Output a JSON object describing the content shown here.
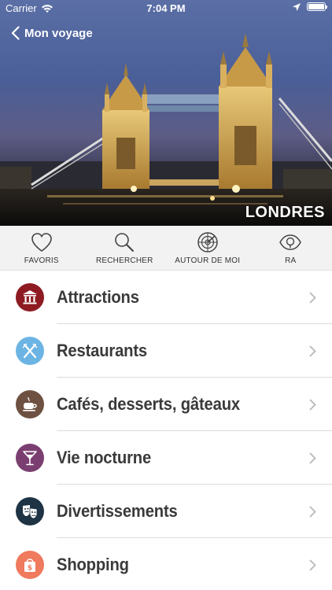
{
  "status_bar": {
    "carrier": "Carrier",
    "time": "7:04 PM"
  },
  "header": {
    "back_label": "Mon voyage",
    "city": "LONDRES"
  },
  "toolbar": {
    "items": [
      {
        "label": "FAVORIS",
        "icon": "heart-icon"
      },
      {
        "label": "RECHERCHER",
        "icon": "search-icon"
      },
      {
        "label": "AUTOUR DE MOI",
        "icon": "radar-icon"
      },
      {
        "label": "RA",
        "icon": "eye-icon"
      }
    ]
  },
  "categories": [
    {
      "label": "Attractions",
      "icon": "museum-icon",
      "color": "#8e1b22"
    },
    {
      "label": "Restaurants",
      "icon": "fork-knife-icon",
      "color": "#6cb4e3"
    },
    {
      "label": "Cafés, desserts, gâteaux",
      "icon": "coffee-cup-icon",
      "color": "#6f5142"
    },
    {
      "label": "Vie nocturne",
      "icon": "cocktail-icon",
      "color": "#7a3f70"
    },
    {
      "label": "Divertissements",
      "icon": "theater-masks-icon",
      "color": "#1e3344"
    },
    {
      "label": "Shopping",
      "icon": "shopping-bag-icon",
      "color": "#ef7a5e"
    }
  ]
}
